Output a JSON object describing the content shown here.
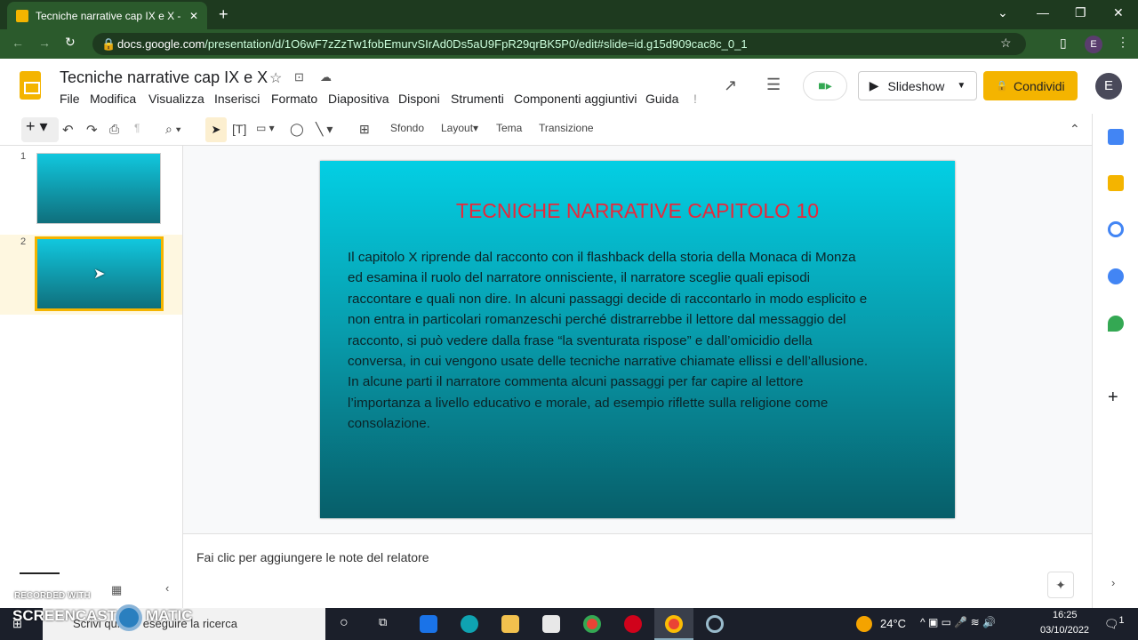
{
  "browser": {
    "tab_title": "Tecniche narrative cap IX e X - Pr",
    "url_domain": "docs.google.com",
    "url_path": "/presentation/d/1O6wF7zZzTw1fobEmurvSIrAd0Ds5aU9FpR29qrBK5P0/edit#slide=id.g15d909cac8c_0_1",
    "profile": "E"
  },
  "app": {
    "doc_title": "Tecniche narrative cap IX e X",
    "menu": [
      "File",
      "Modifica",
      "Visualizza",
      "Inserisci",
      "Formato",
      "Diapositiva",
      "Disponi",
      "Strumenti",
      "Componenti aggiuntivi",
      "Guida",
      "!"
    ],
    "slideshow": "Slideshow",
    "share": "Condividi",
    "avatar": "E"
  },
  "toolbar": {
    "background": "Sfondo",
    "layout": "Layout",
    "theme": "Tema",
    "transition": "Transizione"
  },
  "filmstrip": {
    "slides": [
      "1",
      "2"
    ]
  },
  "slide": {
    "title": "TECNICHE NARRATIVE CAPITOLO 10",
    "lines": [
      "Il capitolo X riprende dal racconto con il flashback della storia della Monaca di Monza",
      "ed esamina il ruolo del narratore onnisciente, il narratore sceglie quali episodi",
      "raccontare e quali non dire. In alcuni passaggi decide di raccontarlo in modo esplicito e",
      "non entra in particolari romanzeschi perché distrarrebbe il lettore dal messaggio del",
      "racconto, si può vedere dalla frase “la sventurata rispose” e dall’omicidio della",
      "conversa, in cui vengono usate delle tecniche narrative chiamate ellissi e dell’allusione.",
      "In alcune parti il narratore commenta alcuni passaggi per far capire al lettore",
      "l’importanza a livello educativo e morale, ad esempio riflette sulla religione come",
      "consolazione."
    ]
  },
  "notes": {
    "placeholder": "Fai clic per aggiungere le note del relatore"
  },
  "watermark": {
    "line1": "RECORDED WITH",
    "line2": "SCREENCAST",
    "line3": "MATIC"
  },
  "taskbar": {
    "search": "Scrivi qui per eseguire la ricerca",
    "temp": "24°C",
    "time": "16:25",
    "date": "03/10/2022",
    "notif": "1"
  },
  "colors": {
    "accent": "#f4b400",
    "title_red": "#e8283a"
  }
}
